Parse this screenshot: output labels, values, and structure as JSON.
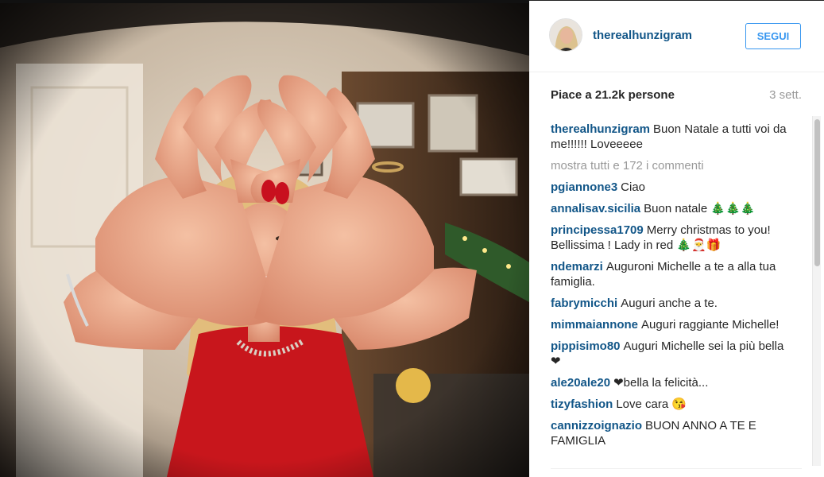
{
  "post": {
    "photo_alt": "photo-heart-hands",
    "author": {
      "username": "therealhunzigram"
    },
    "follow_label": "SEGUI",
    "likes_text": "Piace a 21.2k persone",
    "time_ago": "3 sett.",
    "caption": {
      "user": "therealhunzigram",
      "text": "Buon Natale a tutti voi da me!!!!!! Loveeeee"
    },
    "view_all_label": "mostra tutti e 172 i commenti",
    "comments": [
      {
        "user": "pgiannone3",
        "text": "Ciao"
      },
      {
        "user": "annalisav.sicilia",
        "text": "Buon natale 🎄🎄🎄"
      },
      {
        "user": "principessa1709",
        "text": "Merry christmas to you! Bellissima ! Lady in red 🎄🎅🎁"
      },
      {
        "user": "ndemarzi",
        "text": "Auguroni Michelle a te a alla tua famiglia."
      },
      {
        "user": "fabrymicchi",
        "text": "Auguri anche a te."
      },
      {
        "user": "mimmaiannone",
        "text": "Auguri raggiante Michelle!"
      },
      {
        "user": "pippisimo80",
        "text": "Auguri Michelle sei la più bella❤"
      },
      {
        "user": "ale20ale20",
        "text": "❤bella la felicità..."
      },
      {
        "user": "tizyfashion",
        "text": "Love cara 😘"
      },
      {
        "user": "cannizzoignazio",
        "text": "BUON ANNO A TE E FAMIGLIA"
      }
    ]
  },
  "colors": {
    "username": "#125688",
    "follow": "#3897f0",
    "muted": "#999999",
    "text": "#262626"
  }
}
